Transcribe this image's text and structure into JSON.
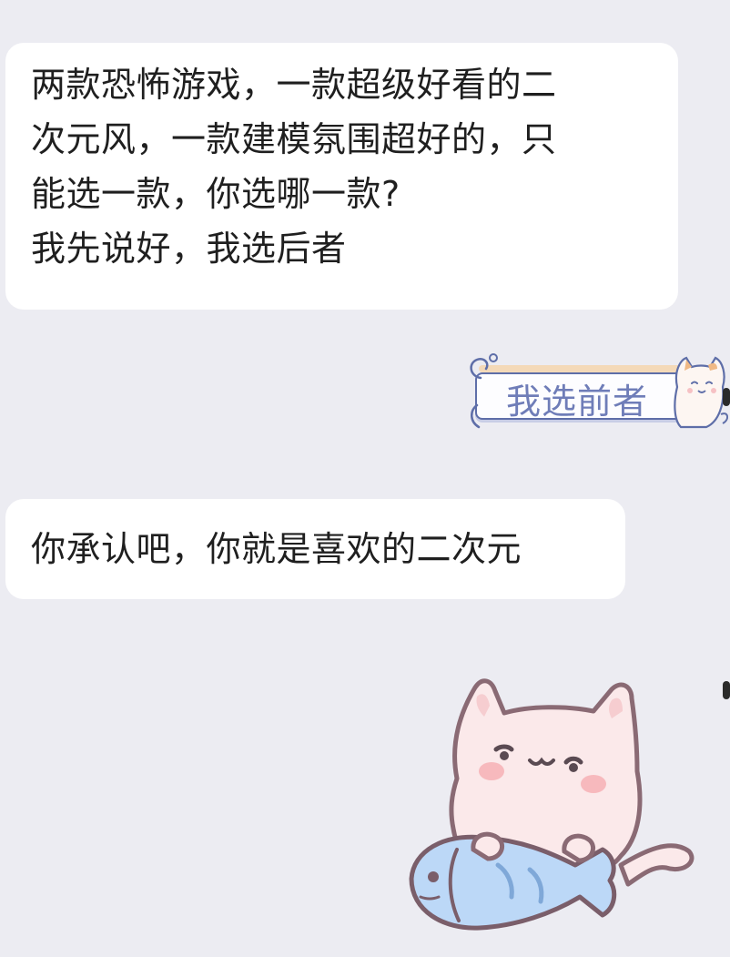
{
  "chat": {
    "messages": [
      {
        "side": "left",
        "lines": [
          "两款恐怖游戏，一款超级好看的二",
          "次元风，一款建模氛围超好的，只",
          "能选一款，你选哪一款?",
          "我先说好，我选后者"
        ]
      },
      {
        "side": "right",
        "type": "sticker",
        "text": "我选前者"
      },
      {
        "side": "left",
        "text": "你承认吧，你就是喜欢的二次元"
      },
      {
        "side": "left",
        "type": "sticker",
        "sticker": "cat-holding-fish-sticker"
      }
    ]
  },
  "colors": {
    "background": "#ececf2",
    "bubble": "#ffffff",
    "sticker_text": "#6f7db8",
    "cat_pink": "#fbe9ea",
    "fish_blue": "#bcd8f7"
  }
}
